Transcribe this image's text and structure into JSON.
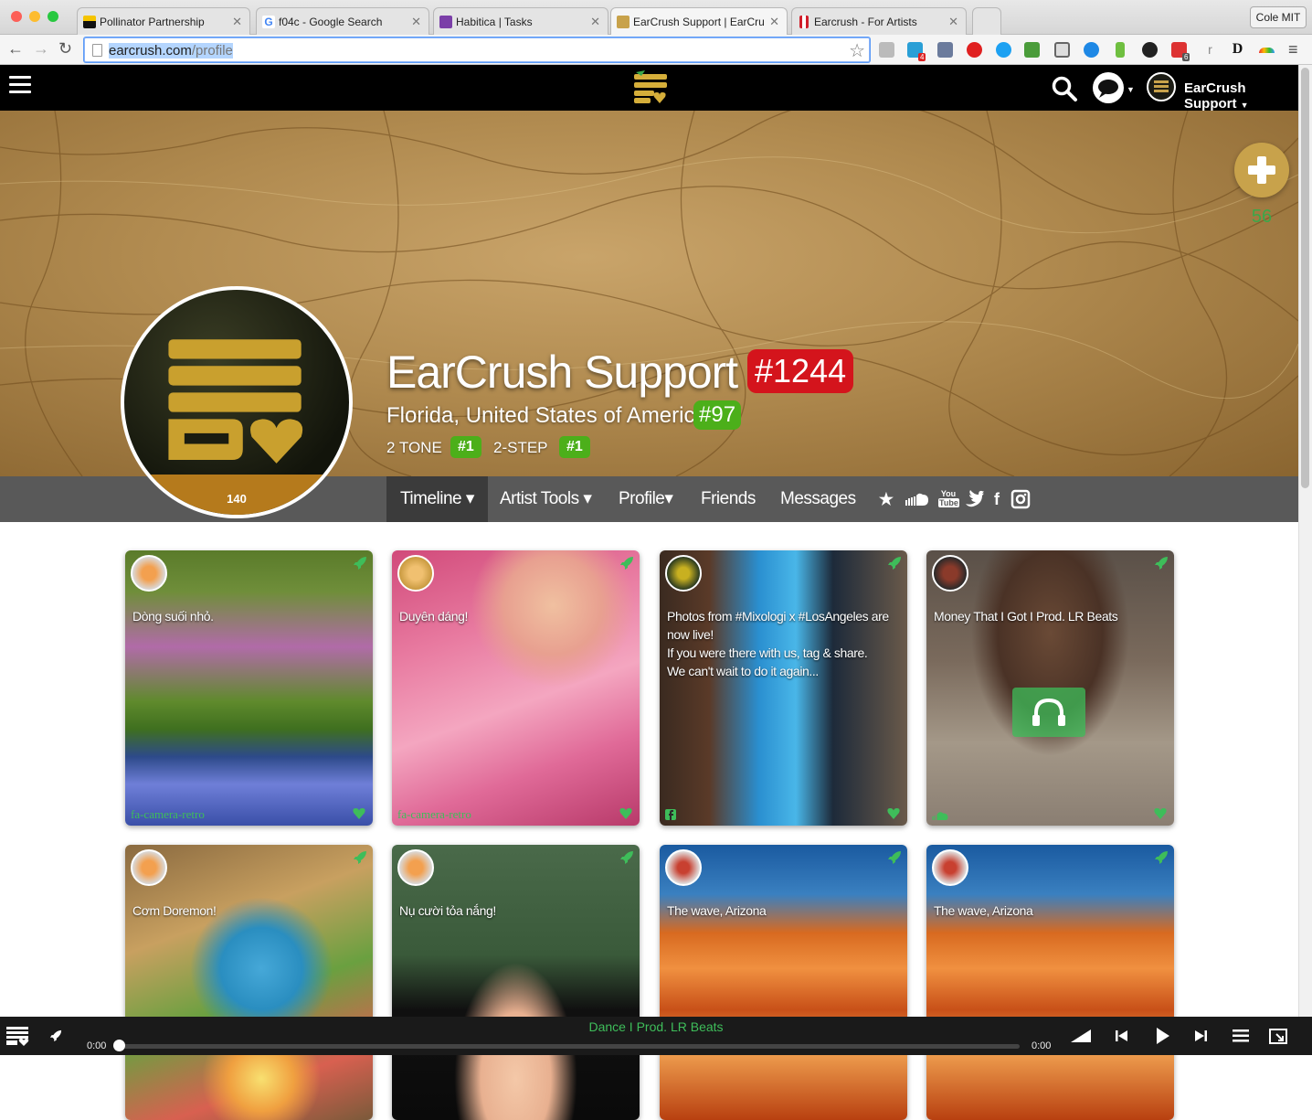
{
  "browser": {
    "tabs": [
      {
        "title": "Pollinator Partnership",
        "fav": "#f5c400"
      },
      {
        "title": "f04c - Google Search",
        "fav": "#4285f4"
      },
      {
        "title": "Habitica | Tasks",
        "fav": "#7b3fa8"
      },
      {
        "title": "EarCrush Support | EarCru",
        "fav": "#c8a24b"
      },
      {
        "title": "Earcrush - For Artists",
        "fav": "#d01e2a"
      }
    ],
    "profile_chip": "Cole MIT",
    "url_host": "earcrush.com",
    "url_path": "/profile",
    "badge_counts": [
      "4",
      "6"
    ]
  },
  "site_nav": {
    "account_name": "EarCrush Support"
  },
  "profile": {
    "name": "EarCrush Support",
    "rank": "#1244",
    "location": "Florida, United States of America",
    "location_rank": "#97",
    "genres": [
      {
        "name": "2 TONE",
        "rank": "#1"
      },
      {
        "name": "2-STEP",
        "rank": "#1"
      }
    ],
    "avatar_count": "140",
    "followers": "56"
  },
  "tabs": [
    {
      "label": "Timeline ▾",
      "active": true
    },
    {
      "label": "Artist Tools ▾"
    },
    {
      "label": "Profile▾"
    },
    {
      "label": "Friends"
    },
    {
      "label": "Messages"
    }
  ],
  "social_icons": [
    "star-icon",
    "soundcloud-icon",
    "youtube-icon",
    "twitter-icon",
    "facebook-icon",
    "instagram-icon"
  ],
  "youtube_text": {
    "top": "You",
    "bottom": "Tube"
  },
  "cards": [
    {
      "text": "Dòng suối nhỏ.",
      "source": "fa-camera-retro"
    },
    {
      "text": "Duyên dáng!",
      "source": "fa-camera-retro"
    },
    {
      "text": "Photos from #Mixologi x #LosAngeles are now live!\nIf you were there with us, tag & share.\nWe can't wait to do it again...",
      "source": ""
    },
    {
      "text": "Money That I Got I Prod. LR Beats",
      "source": ""
    },
    {
      "text": "Cơm Doremon!",
      "source": ""
    },
    {
      "text": "Nụ cười tỏa nắng!",
      "source": ""
    },
    {
      "text": "The wave, Arizona",
      "source": ""
    },
    {
      "text": "The wave, Arizona",
      "source": ""
    }
  ],
  "player": {
    "now_playing": "Dance I Prod. LR Beats",
    "time_start": "0:00",
    "time_end": "0:00"
  }
}
